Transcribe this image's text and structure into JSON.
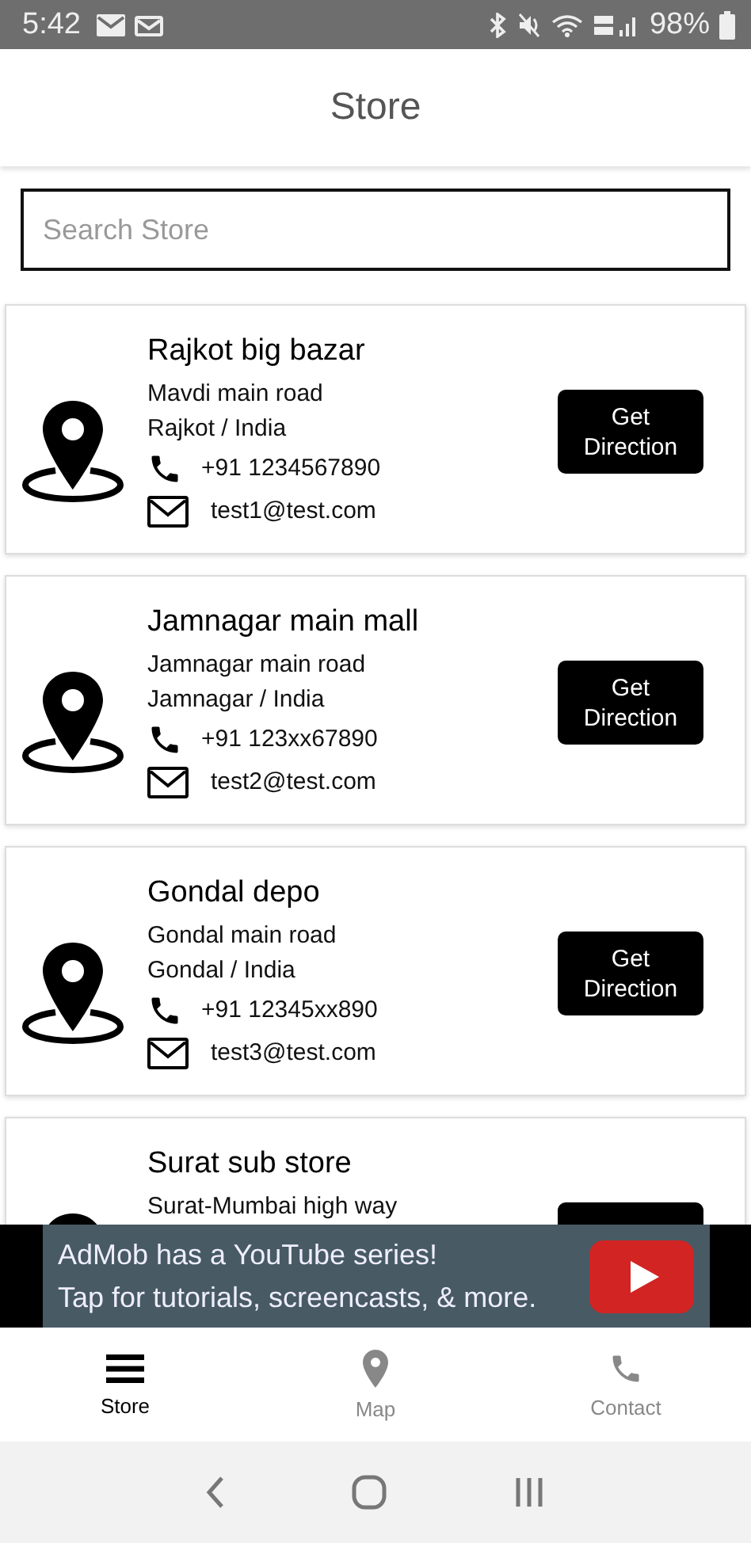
{
  "status_bar": {
    "time": "5:42",
    "battery": "98%"
  },
  "header": {
    "title": "Store"
  },
  "search": {
    "placeholder": "Search Store"
  },
  "stores": [
    {
      "name": "Rajkot big bazar",
      "address": "Mavdi main road",
      "city": "Rajkot / India",
      "phone": "+91 1234567890",
      "email": "test1@test.com",
      "button": "Get\nDirection"
    },
    {
      "name": "Jamnagar main mall",
      "address": "Jamnagar main road",
      "city": "Jamnagar / India",
      "phone": "+91 123xx67890",
      "email": "test2@test.com",
      "button": "Get\nDirection"
    },
    {
      "name": "Gondal depo",
      "address": "Gondal main road",
      "city": "Gondal / India",
      "phone": "+91 12345xx890",
      "email": "test3@test.com",
      "button": "Get\nDirection"
    },
    {
      "name": "Surat sub store",
      "address": "Surat-Mumbai high way"
    }
  ],
  "ad": {
    "line_1": "AdMob has a YouTube series!",
    "line_2": "Tap for tutorials, screencasts, & more."
  },
  "bottom_nav": [
    {
      "label": "Store",
      "kind": "menu",
      "selected": true
    },
    {
      "label": "Map",
      "kind": "pin",
      "selected": false
    },
    {
      "label": "Contact",
      "kind": "phone",
      "selected": false
    }
  ]
}
